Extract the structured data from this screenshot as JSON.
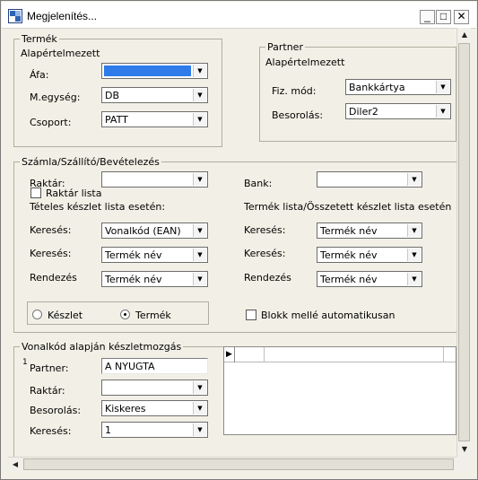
{
  "window": {
    "title": "Megjelenítés...",
    "minimize": "_",
    "maximize": "□",
    "close": "✕"
  },
  "termek": {
    "title": "Termék",
    "subtitle": "Alapértelmezett",
    "afa_label": "Áfa:",
    "afa_value": "",
    "megyseg_label": "M.egység:",
    "megyseg_value": "DB",
    "csoport_label": "Csoport:",
    "csoport_value": "PATT"
  },
  "partner": {
    "title": "Partner",
    "subtitle": "Alapértelmezett",
    "fizmod_label": "Fiz. mód:",
    "fizmod_value": "Bankkártya",
    "besorolas_label": "Besorolás:",
    "besorolas_value": "Diler2"
  },
  "szamla": {
    "title": "Számla/Szállító/Bevételezés",
    "raktar_label": "Raktár:",
    "raktar_value": "",
    "bank_label": "Bank:",
    "bank_value": "",
    "raktar_lista_label": "Raktár lista",
    "teteles_title": "Tételes készlet lista esetén:",
    "termeklista_title": "Termék lista/Összetett készlet lista esetén",
    "left": {
      "kereses1_label": "Keresés:",
      "kereses1_value": "Vonalkód (EAN)",
      "kereses2_label": "Keresés:",
      "kereses2_value": "Termék név",
      "rendezes_label": "Rendezés",
      "rendezes_value": "Termék név"
    },
    "right": {
      "kereses1_label": "Keresés:",
      "kereses1_value": "Termék név",
      "kereses2_label": "Keresés:",
      "kereses2_value": "Termék név",
      "rendezes_label": "Rendezés",
      "rendezes_value": "Termék név"
    },
    "radio_keszlet": "Készlet",
    "radio_termek": "Termék",
    "radio_selected": "Termék",
    "blokk_label": "Blokk mellé automatikusan"
  },
  "vonalkod": {
    "title": "Vonalkód alapján készletmozgás",
    "marker": "1",
    "partner_label": "Partner:",
    "partner_value": "A NYUGTA",
    "raktar_label": "Raktár:",
    "raktar_value": "",
    "besorolas_label": "Besorolás:",
    "besorolas_value": "Kiskeres",
    "kereses_label": "Keresés:",
    "kereses_value": "1",
    "grid_indicator": "▶"
  },
  "icons": {
    "dropdown": "▼",
    "scroll_up": "▲",
    "scroll_down": "▼",
    "scroll_left": "◀",
    "scroll_right": "▶"
  }
}
